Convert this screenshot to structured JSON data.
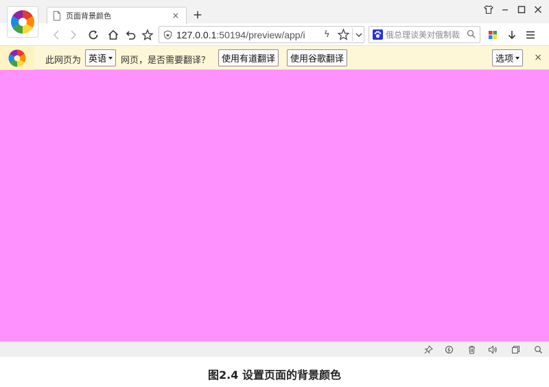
{
  "browser": {
    "tab": {
      "title": "页面背景颜色",
      "close_glyph": "×"
    },
    "new_tab_glyph": "+",
    "window_controls": [
      "skin-icon",
      "minimize-icon",
      "maximize-icon",
      "close-icon"
    ],
    "address": {
      "host": "127.0.0.1",
      "rest": ":50194/preview/app/i",
      "bolt_glyph": "ϟ"
    },
    "search": {
      "placeholder": "俄总理谈美对俄制裁"
    }
  },
  "translate_bar": {
    "prefix": "此网页为",
    "language": "英语",
    "suffix": "网页，是否需要翻译？",
    "youdao_button": "使用有道翻译",
    "google_button": "使用谷歌翻译",
    "options_button": "选项",
    "close_glyph": "×"
  },
  "page": {
    "background": "#ff91ff"
  },
  "caption": "图2.4  设置页面的背景颜色"
}
